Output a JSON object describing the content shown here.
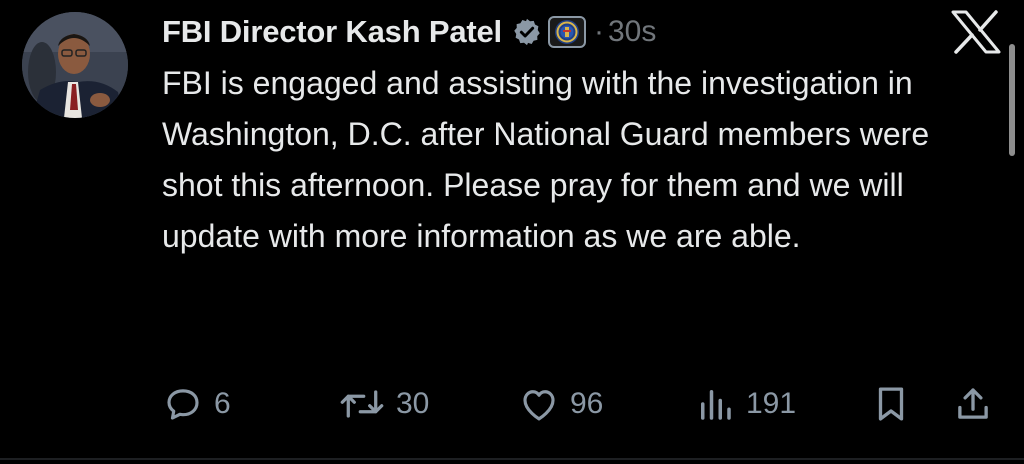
{
  "author": {
    "display_name": "FBI Director Kash Patel",
    "verified": true,
    "affiliate_badge": "fbi-seal-icon"
  },
  "timestamp": "30s",
  "separator": "·",
  "tweet_text": "FBI is engaged and assisting with the investigation in Washington, D.C. after National Guard members were shot this afternoon. Please pray for them and we will update with more information as we are able.",
  "actions": {
    "replies": "6",
    "reposts": "30",
    "likes": "96",
    "views": "191"
  },
  "colors": {
    "background": "#000000",
    "text": "#e7e9ea",
    "muted": "#71767b",
    "icon": "#8b98a5",
    "verified": "#8b98a5"
  },
  "icons": [
    "reply-icon",
    "repost-icon",
    "like-icon",
    "views-icon",
    "bookmark-icon",
    "share-icon",
    "x-logo-icon",
    "verified-icon"
  ]
}
